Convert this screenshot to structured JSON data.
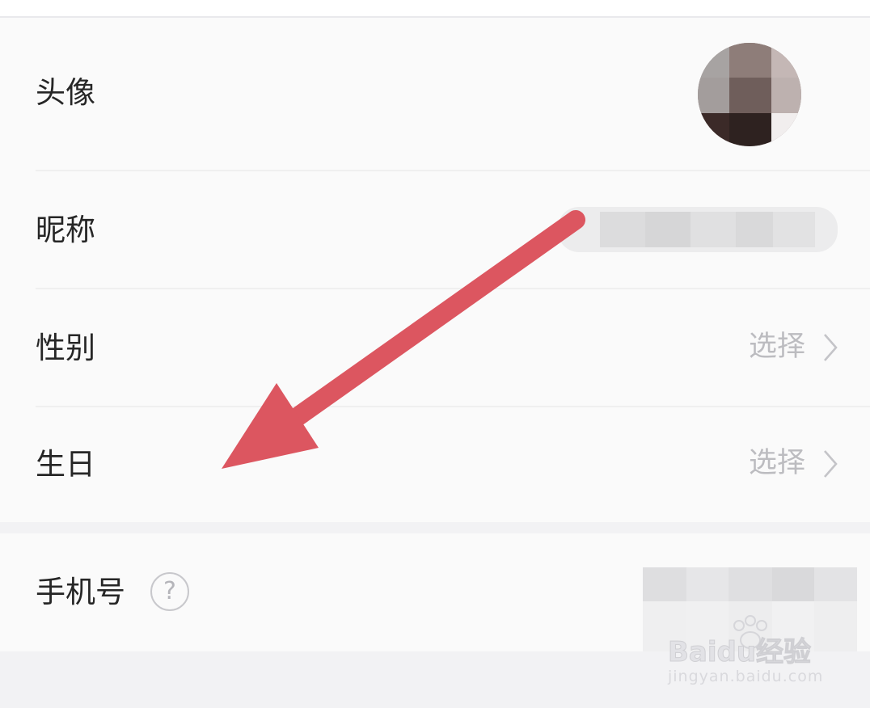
{
  "profile": {
    "avatar_label": "头像",
    "nickname_label": "昵称",
    "gender_label": "性别",
    "gender_value": "选择",
    "birthday_label": "生日",
    "birthday_value": "选择",
    "phone_label": "手机号",
    "help_glyph": "?"
  },
  "icons": {
    "chevron": "chevron-right-icon",
    "help": "question-circle-icon",
    "annotation": "red-arrow"
  },
  "colors": {
    "annotation_arrow": "#dc5660",
    "value_text": "#bcbcc0",
    "label_text": "#262626"
  },
  "watermark": {
    "brand": "Baidu经验",
    "url": "jingyan.baidu.com"
  }
}
